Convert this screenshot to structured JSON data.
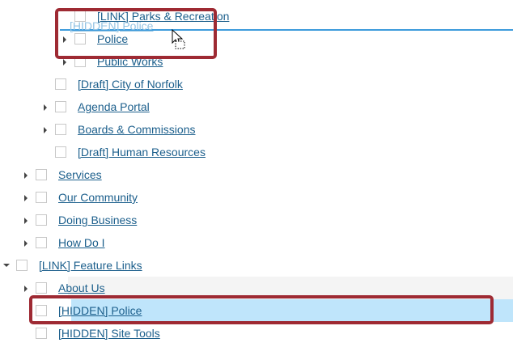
{
  "tree": {
    "rows": [
      {
        "label": "[LINK] Parks & Recreation",
        "level": 4,
        "expandable": false,
        "expanded": false
      },
      {
        "label": "Police",
        "level": 4,
        "expandable": true,
        "expanded": false
      },
      {
        "label": "Public Works",
        "level": 4,
        "expandable": true,
        "expanded": false
      },
      {
        "label": "[Draft] City of Norfolk",
        "level": 3,
        "expandable": false,
        "expanded": false
      },
      {
        "label": "Agenda Portal",
        "level": 3,
        "expandable": true,
        "expanded": false
      },
      {
        "label": "Boards & Commissions",
        "level": 3,
        "expandable": true,
        "expanded": false
      },
      {
        "label": "[Draft] Human Resources",
        "level": 3,
        "expandable": false,
        "expanded": false
      },
      {
        "label": "Services",
        "level": 2,
        "expandable": true,
        "expanded": false
      },
      {
        "label": "Our Community",
        "level": 2,
        "expandable": true,
        "expanded": false
      },
      {
        "label": "Doing Business",
        "level": 2,
        "expandable": true,
        "expanded": false
      },
      {
        "label": "How Do I",
        "level": 2,
        "expandable": true,
        "expanded": false
      },
      {
        "label": "[LINK] Feature Links",
        "level": 1,
        "expandable": true,
        "expanded": true
      },
      {
        "label": "About Us",
        "level": 2,
        "expandable": true,
        "expanded": false,
        "state": "hover"
      },
      {
        "label": "[HIDDEN] Police",
        "level": 2,
        "expandable": false,
        "expanded": false,
        "state": "selected"
      },
      {
        "label": "[HIDDEN] Site Tools",
        "level": 2,
        "expandable": false,
        "expanded": false
      }
    ]
  },
  "drag": {
    "ghost_label": "[HIDDEN] Police"
  },
  "colors": {
    "link": "#1c5f8c",
    "selected_bg": "#bfe5fb",
    "highlight_border": "#9e2a33",
    "drop_line": "#3d9bdc"
  },
  "icons": {
    "expand": "caret-right-icon",
    "collapse": "caret-down-icon",
    "cursor": "drag-cursor-icon"
  }
}
